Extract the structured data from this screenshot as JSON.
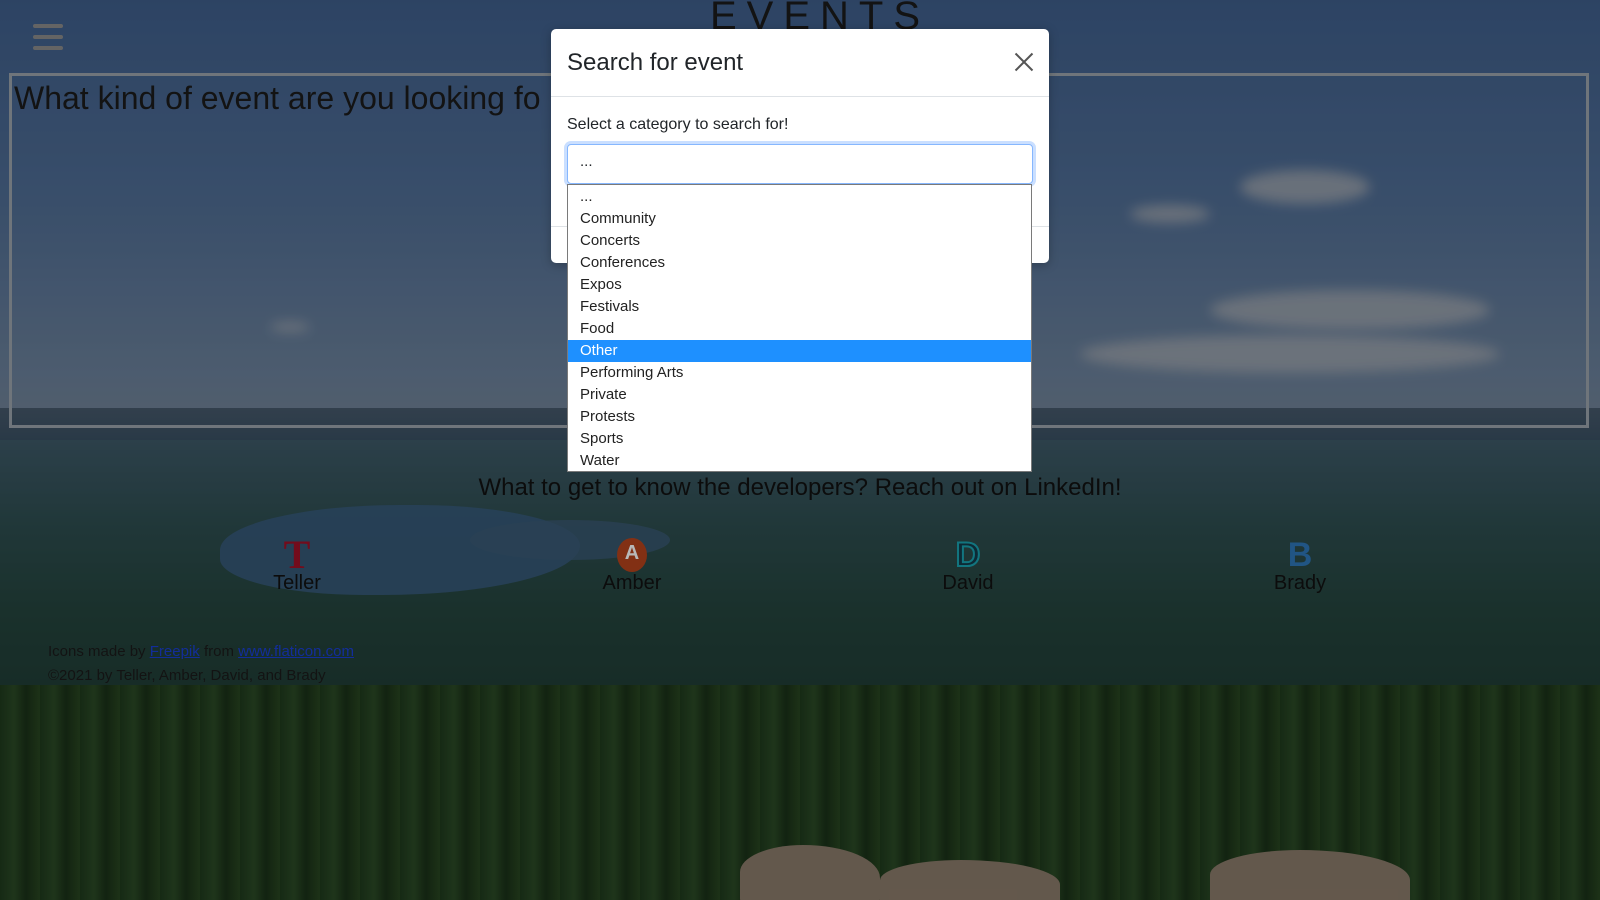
{
  "header": {
    "site_title": "EVENTS",
    "menu_icon": "hamburger-menu-icon"
  },
  "main": {
    "question": "What kind of event are you looking fo"
  },
  "developers": {
    "heading": "What to get to know the developers? Reach out on LinkedIn!",
    "people": [
      {
        "name": "Teller",
        "glyph": "T",
        "icon": "teller-letter-icon",
        "color": "#a01128"
      },
      {
        "name": "Amber",
        "glyph": "A",
        "icon": "amber-letter-icon",
        "color": "#b4431c"
      },
      {
        "name": "David",
        "glyph": "D",
        "icon": "david-letter-icon",
        "color": "#1aa3b0"
      },
      {
        "name": "Brady",
        "glyph": "B",
        "icon": "brady-letter-icon",
        "color": "#2e77b7"
      }
    ]
  },
  "footer": {
    "credit_prefix": "Icons made by",
    "credit_author": "Freepik",
    "credit_mid": "from",
    "credit_site": "www.flaticon.com",
    "copyright": "©2021 by Teller, Amber, David, and Brady"
  },
  "modal": {
    "title": "Search for event",
    "close_icon": "close-icon",
    "select_label": "Select a category to search for!",
    "select_value": "...",
    "options": [
      "...",
      "Community",
      "Concerts",
      "Conferences",
      "Expos",
      "Festivals",
      "Food",
      "Other",
      "Performing Arts",
      "Private",
      "Protests",
      "Sports",
      "Water"
    ],
    "highlighted_option": "Other",
    "highlight_color": "#1e90ff"
  }
}
